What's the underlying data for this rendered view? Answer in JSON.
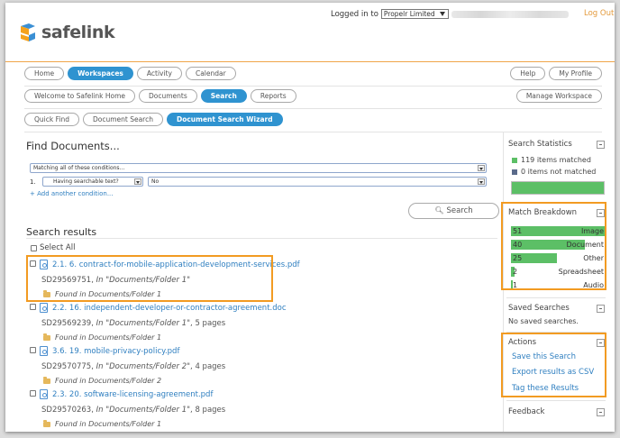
{
  "header": {
    "logo_text": "safelink",
    "logged_in_label": "Logged in to",
    "organization": "Propelr Limited",
    "logout_label": "Log Out"
  },
  "nav": {
    "primary": [
      "Home",
      "Workspaces",
      "Activity",
      "Calendar"
    ],
    "primary_active": "Workspaces",
    "utility": [
      "Help",
      "My Profile"
    ],
    "secondary": [
      "Welcome to Safelink Home",
      "Documents",
      "Search",
      "Reports"
    ],
    "secondary_active": "Search",
    "manage_label": "Manage Workspace",
    "tertiary": [
      "Quick Find",
      "Document Search",
      "Document Search Wizard"
    ],
    "tertiary_active": "Document Search Wizard"
  },
  "find": {
    "title": "Find Documents...",
    "match_mode": "Matching all of these conditions...",
    "condition_number": "1.",
    "condition_field": "Having searchable text?",
    "condition_value": "No",
    "add_condition": "+ Add another condition...",
    "search_label": "Search"
  },
  "results": {
    "title": "Search results",
    "select_all": "Select All",
    "items": [
      {
        "title": "2.1. 6. contract-for-mobile-application-development-services.pdf",
        "id": "SD29569751,",
        "location": "In \"Documents/Folder 1\"",
        "pages": "",
        "found": "Found in Documents/Folder 1"
      },
      {
        "title": "2.2. 16. independent-developer-or-contractor-agreement.doc",
        "id": "SD29569239,",
        "location": "In \"Documents/Folder 1\"",
        "pages": ", 5 pages",
        "found": "Found in Documents/Folder 1"
      },
      {
        "title": "3.6. 19. mobile-privacy-policy.pdf",
        "id": "SD29570775,",
        "location": "In \"Documents/Folder 2\"",
        "pages": ", 4 pages",
        "found": "Found in Documents/Folder 2"
      },
      {
        "title": "2.3. 20. software-licensing-agreement.pdf",
        "id": "SD29570263,",
        "location": "In \"Documents/Folder 1\"",
        "pages": ", 8 pages",
        "found": "Found in Documents/Folder 1"
      }
    ]
  },
  "sidebar": {
    "stats_title": "Search Statistics",
    "matched": "119 items matched",
    "not_matched": "0 items not matched",
    "matched_fraction": 1.0,
    "breakdown_title": "Match Breakdown",
    "breakdown": [
      {
        "count": "51",
        "label": "Image",
        "value": 51
      },
      {
        "count": "40",
        "label": "Document",
        "value": 40
      },
      {
        "count": "25",
        "label": "Other",
        "value": 25
      },
      {
        "count": "2",
        "label": "Spreadsheet",
        "value": 2
      },
      {
        "count": "1",
        "label": "Audio",
        "value": 1
      }
    ],
    "saved_title": "Saved Searches",
    "saved_empty": "No saved searches.",
    "actions_title": "Actions",
    "actions": [
      "Save this Search",
      "Export results as CSV",
      "Tag these Results"
    ],
    "feedback_title": "Feedback"
  },
  "colors": {
    "accent": "#2f93d0",
    "highlight": "#f29b22",
    "bar_green": "#5cbf66",
    "link": "#2f7fc0"
  }
}
